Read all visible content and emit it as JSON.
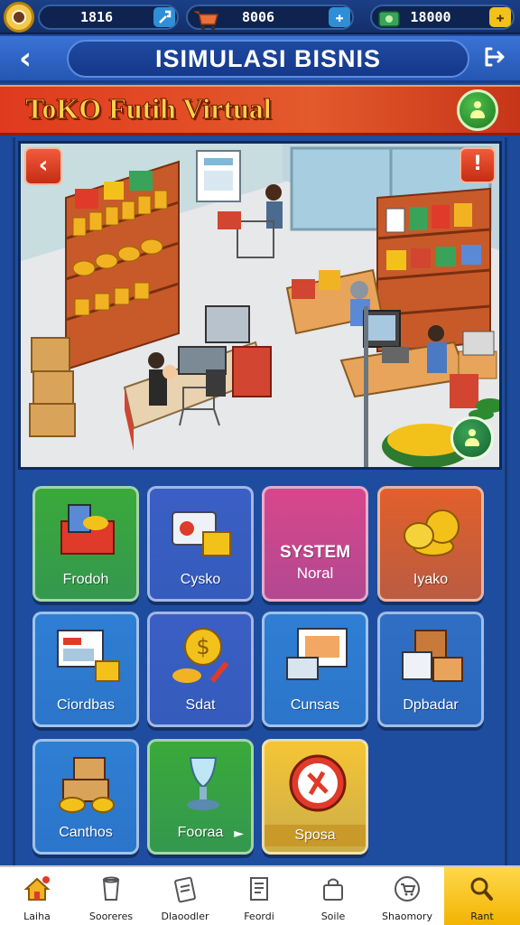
{
  "resources": [
    {
      "value": "1816",
      "button": "wrench-icon",
      "color": "#2f8fd6"
    },
    {
      "value": "8006",
      "button": "plus-icon",
      "color": "#2f8fd6"
    },
    {
      "value": "18000",
      "button": "plus-icon",
      "color": "#f2c21b"
    }
  ],
  "header": {
    "title": "ISIMULASI BISNIS"
  },
  "banner": {
    "text": "ToKO Futih Virtual"
  },
  "menu": [
    {
      "label": "Frodoh",
      "color": "#3aaa3a",
      "icon": "basket-icon"
    },
    {
      "label": "Cysko",
      "color": "#3b5fc4",
      "icon": "register-icon"
    },
    {
      "label": "",
      "title": "SYSTEM",
      "subtitle": "Noral",
      "color": "#d8478c"
    },
    {
      "label": "Iyako",
      "color": "#e2602a",
      "icon": "coins-icon"
    },
    {
      "label": "Ciordbas",
      "color": "#2f7fd4",
      "icon": "monitor-icon"
    },
    {
      "label": "Sdat",
      "color": "#3b5fc4",
      "icon": "dollar-icon"
    },
    {
      "label": "Cunsas",
      "color": "#2f7fd4",
      "icon": "computer-icon"
    },
    {
      "label": "Dpbadar",
      "color": "#2f6fc4",
      "icon": "boxes-icon"
    },
    {
      "label": "Canthos",
      "color": "#2f7fd4",
      "icon": "boxes-gold-icon"
    },
    {
      "label": "Fooraa",
      "color": "#3aaa3a",
      "icon": "trophy-icon"
    },
    {
      "label": "Sposa",
      "color": "#f6c534",
      "icon": "badge-icon"
    }
  ],
  "nav": [
    {
      "label": "Laiha",
      "icon": "home-icon",
      "active": false
    },
    {
      "label": "Sooreres",
      "icon": "cup-icon",
      "active": false
    },
    {
      "label": "Dlaoodler",
      "icon": "clipboard-icon",
      "active": false
    },
    {
      "label": "Feordi",
      "icon": "document-icon",
      "active": false
    },
    {
      "label": "Soile",
      "icon": "bag-icon",
      "active": false
    },
    {
      "label": "Shaomory",
      "icon": "cart-icon",
      "active": false
    },
    {
      "label": "Rant",
      "icon": "search-icon",
      "active": true
    }
  ]
}
